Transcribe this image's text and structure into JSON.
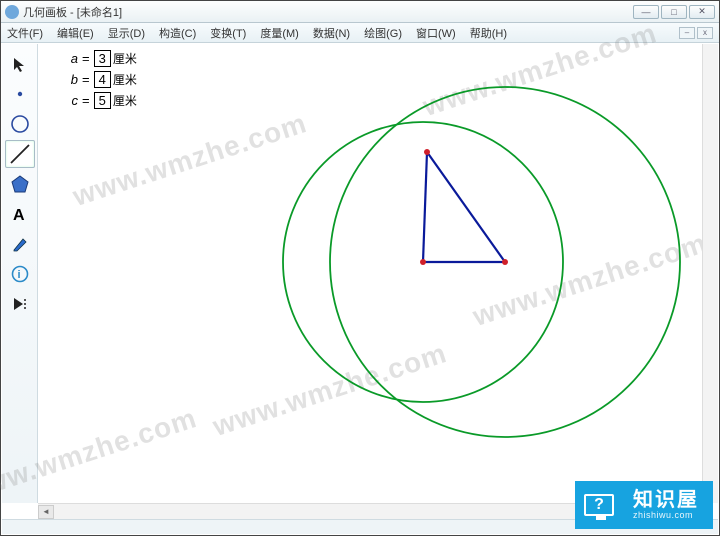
{
  "title": "几何画板 - [未命名1]",
  "window_buttons": {
    "min": "—",
    "max": "□",
    "close": "✕"
  },
  "menu": [
    "文件(F)",
    "编辑(E)",
    "显示(D)",
    "构造(C)",
    "变换(T)",
    "度量(M)",
    "数据(N)",
    "绘图(G)",
    "窗口(W)",
    "帮助(H)"
  ],
  "doc_buttons": {
    "min": "–",
    "close": "x"
  },
  "params": [
    {
      "var": "a",
      "value": "3",
      "unit": "厘米"
    },
    {
      "var": "b",
      "value": "4",
      "unit": "厘米"
    },
    {
      "var": "c",
      "value": "5",
      "unit": "厘米"
    }
  ],
  "watermark": "www.wmzhe.com",
  "brand": {
    "cn": "知识屋",
    "en": "zhishiwu.com",
    "mark": "?"
  },
  "scroll": {
    "left": "◄",
    "right": "►",
    "split": "||||"
  }
}
